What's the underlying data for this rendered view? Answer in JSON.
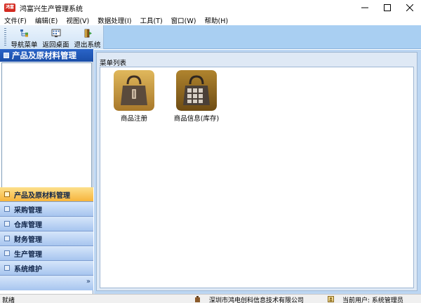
{
  "window": {
    "title": "鸿富兴生产管理系统",
    "icon_text": "鸿富",
    "icon_color": "#d42a20"
  },
  "menu": [
    "文件(F)",
    "编辑(E)",
    "视图(V)",
    "数据处理(I)",
    "工具(T)",
    "窗口(W)",
    "帮助(H)"
  ],
  "toolbar": {
    "buttons": [
      {
        "label": "导航菜单",
        "icon": "navigation-icon"
      },
      {
        "label": "返回桌面",
        "icon": "desktop-icon"
      },
      {
        "label": "退出系统",
        "icon": "exit-icon"
      }
    ]
  },
  "sidebar": {
    "header": "产品及原材料管理",
    "items": [
      {
        "label": "产品及原材料管理",
        "active": true
      },
      {
        "label": "采购管理",
        "active": false
      },
      {
        "label": "仓库管理",
        "active": false
      },
      {
        "label": "财务管理",
        "active": false
      },
      {
        "label": "生产管理",
        "active": false
      },
      {
        "label": "系统维护",
        "active": false
      }
    ]
  },
  "main": {
    "panel_title": "菜单列表",
    "items": [
      {
        "label": "商品注册",
        "icon": "product-register-icon",
        "color": "#c99a3c"
      },
      {
        "label": "商品信息(库存)",
        "icon": "product-inventory-icon",
        "color": "#8a6420"
      }
    ]
  },
  "status": {
    "ready": "就绪",
    "company": "深圳市鸿电创科信息技术有限公司",
    "user": "当前用户: 系统管理员"
  },
  "colors": {
    "accent": "#1a4ea8",
    "active_nav": "#f6b43c",
    "toolbar_bg": "#a9cff2"
  }
}
